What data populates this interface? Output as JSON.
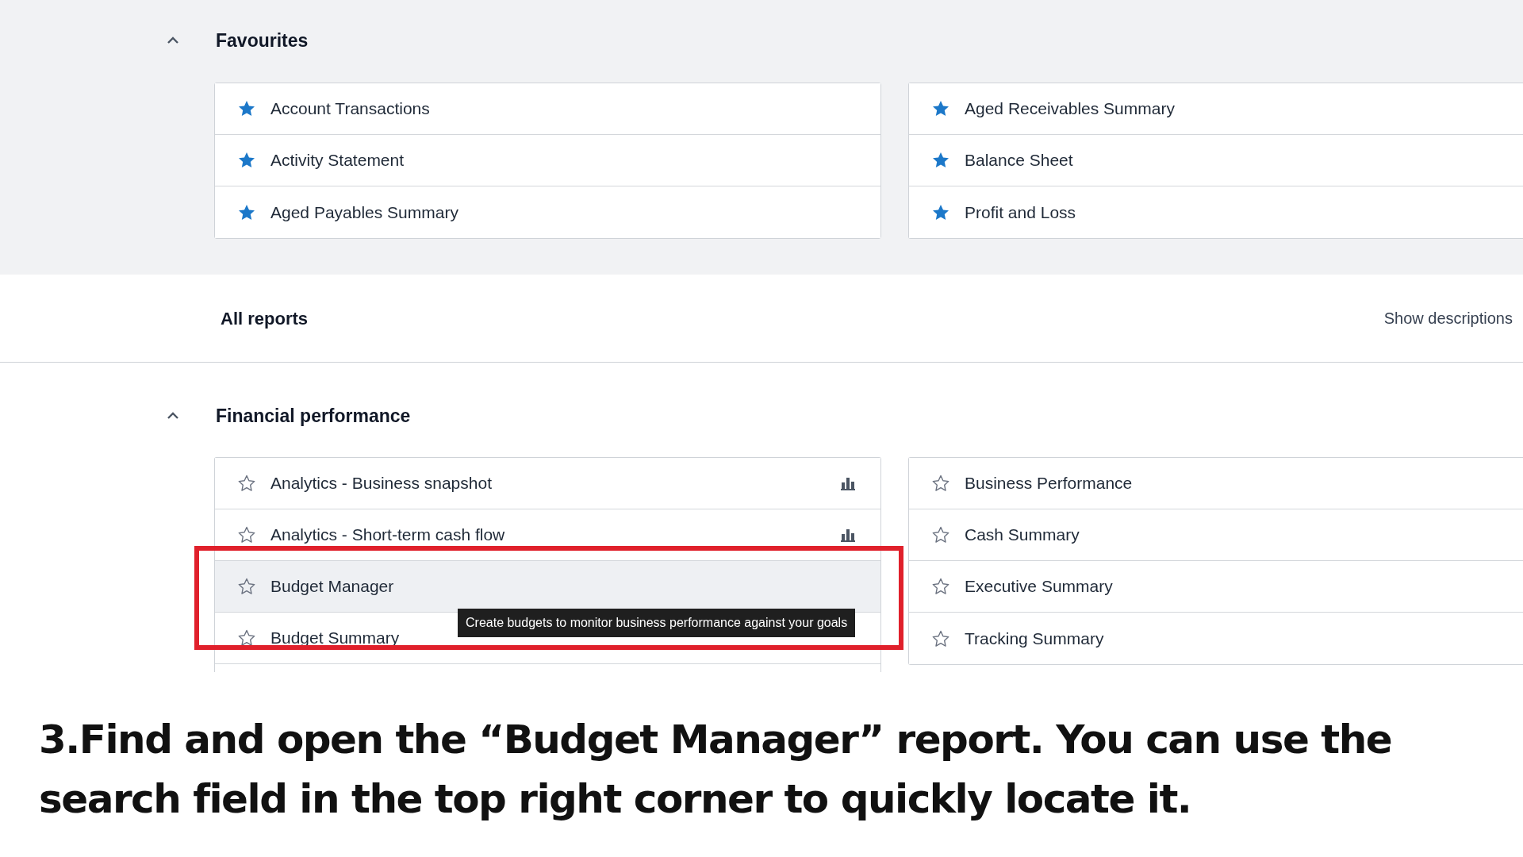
{
  "favourites": {
    "title": "Favourites",
    "expanded": true,
    "columns": [
      [
        {
          "label": "Account Transactions",
          "favourite": true,
          "chart": false,
          "highlighted": false
        },
        {
          "label": "Activity Statement",
          "favourite": true,
          "chart": false,
          "highlighted": false
        },
        {
          "label": "Aged Payables Summary",
          "favourite": true,
          "chart": false,
          "highlighted": false
        }
      ],
      [
        {
          "label": "Aged Receivables Summary",
          "favourite": true,
          "chart": false,
          "highlighted": false
        },
        {
          "label": "Balance Sheet",
          "favourite": true,
          "chart": false,
          "highlighted": false
        },
        {
          "label": "Profit and Loss",
          "favourite": true,
          "chart": false,
          "highlighted": false
        }
      ]
    ]
  },
  "all_reports": {
    "title": "All reports",
    "toggle_label": "Show descriptions"
  },
  "financial_performance": {
    "title": "Financial performance",
    "expanded": true,
    "columns": [
      [
        {
          "label": "Analytics - Business snapshot",
          "favourite": false,
          "chart": true,
          "highlighted": false
        },
        {
          "label": "Analytics - Short-term cash flow",
          "favourite": false,
          "chart": true,
          "highlighted": false
        },
        {
          "label": "Budget Manager",
          "favourite": false,
          "chart": false,
          "highlighted": true
        },
        {
          "label": "Budget Summary",
          "favourite": false,
          "chart": false,
          "highlighted": false
        }
      ],
      [
        {
          "label": "Business Performance",
          "favourite": false,
          "chart": false,
          "highlighted": false
        },
        {
          "label": "Cash Summary",
          "favourite": false,
          "chart": false,
          "highlighted": false
        },
        {
          "label": "Executive Summary",
          "favourite": false,
          "chart": false,
          "highlighted": false
        },
        {
          "label": "Tracking Summary",
          "favourite": false,
          "chart": false,
          "highlighted": false
        }
      ]
    ]
  },
  "tooltip": {
    "text": "Create budgets to monitor business performance against your goals"
  },
  "caption": "3.Find and open the “Budget Manager” report. You can use the search field in the top right corner to quickly locate it."
}
